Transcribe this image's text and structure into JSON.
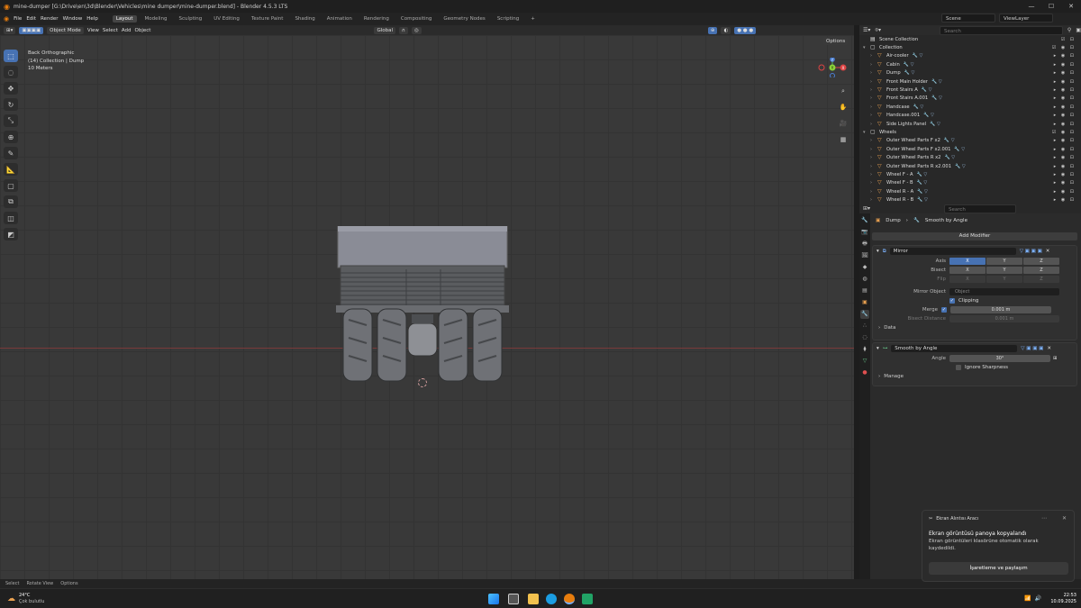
{
  "window": {
    "title": "mine-dumper [G:\\Drive\\en\\3d\\Blender\\Vehicles\\mine dumper\\mine-dumper.blend] - Blender 4.5.3 LTS"
  },
  "menus": [
    "File",
    "Edit",
    "Render",
    "Window",
    "Help"
  ],
  "workspaces": [
    "Layout",
    "Modeling",
    "Sculpting",
    "UV Editing",
    "Texture Paint",
    "Shading",
    "Animation",
    "Rendering",
    "Compositing",
    "Geometry Nodes",
    "Scripting"
  ],
  "active_workspace": "Layout",
  "scene": {
    "name": "Scene",
    "view_layer": "ViewLayer"
  },
  "viewport_header": {
    "mode": "Object Mode",
    "menus": [
      "View",
      "Select",
      "Add",
      "Object"
    ],
    "orientation": "Global",
    "options": "Options"
  },
  "viewport_info": {
    "view": "Back Orthographic",
    "collection": "(14) Collection | Dump",
    "scale": "10 Meters"
  },
  "gizmo_axes": {
    "x": "X",
    "y": "Y",
    "z": "Z"
  },
  "outliner": {
    "search_placeholder": "Search",
    "root": "Scene Collection",
    "collection": "Collection",
    "items": [
      "Air-cooler",
      "Cabin",
      "Dump",
      "Front Main Holder",
      "Front Stairs A",
      "Front Stairs A.001",
      "Handcase",
      "Handcase.001",
      "Side Lights Panel"
    ],
    "wheels_collection": "Wheels",
    "wheel_items": [
      "Outer Wheel Parts F x2",
      "Outer Wheel Parts F x2.001",
      "Outer Wheel Parts R x2",
      "Outer Wheel Parts R x2.001",
      "Wheel F - A",
      "Wheel F - B",
      "Wheel R - A",
      "Wheel R - B"
    ]
  },
  "properties": {
    "search_placeholder": "Search",
    "breadcrumb_object": "Dump",
    "breadcrumb_modifier": "Smooth by Angle",
    "add_modifier": "Add Modifier",
    "mirror": {
      "name": "Mirror",
      "axis_label": "Axis",
      "bisect_label": "Bisect",
      "flip_label": "Flip",
      "axes": [
        "X",
        "Y",
        "Z"
      ],
      "mirror_object_label": "Mirror Object",
      "mirror_object_placeholder": "Object",
      "clipping_label": "Clipping",
      "merge_label": "Merge",
      "merge_value": "0.001 m",
      "bisect_distance_label": "Bisect Distance",
      "bisect_distance_value": "0.001 m",
      "data_label": "Data"
    },
    "smooth": {
      "name": "Smooth by Angle",
      "angle_label": "Angle",
      "angle_value": "30°",
      "ignore_sharpness_label": "Ignore Sharpness",
      "manage_label": "Manage"
    }
  },
  "statusbar": [
    "Select",
    "Rotate View",
    "Options"
  ],
  "notification": {
    "app": "Ekran Alıntısı Aracı",
    "title": "Ekran görüntüsü panoya kopyalandı",
    "body": "Ekran görüntüleri klasörüne otomatik olarak kaydedildi.",
    "button": "İşaretleme ve paylaşım"
  },
  "taskbar": {
    "temp": "24°C",
    "weather": "Çok bulutlu",
    "time": "22:53",
    "date": "10.09.2025"
  },
  "colors": {
    "accent": "#4772b3",
    "orange": "#e8a050",
    "green": "#68c78a"
  }
}
